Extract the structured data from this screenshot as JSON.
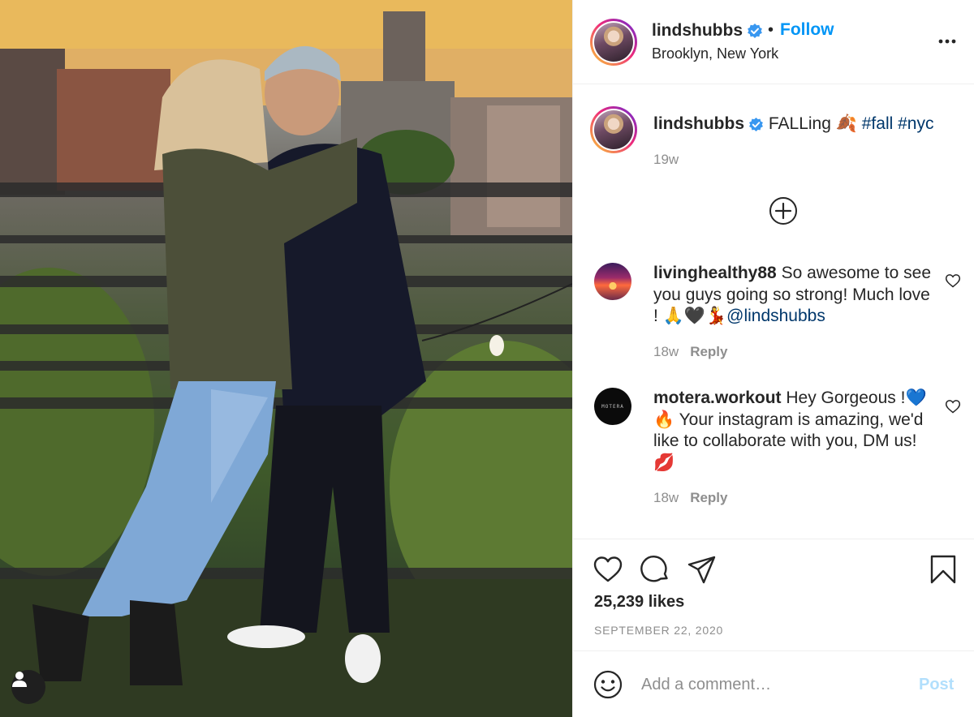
{
  "post": {
    "username": "lindshubbs",
    "follow_label": "Follow",
    "location": "Brooklyn, New York",
    "more_icon": "more-options-icon",
    "verified_color": "#3897f0"
  },
  "caption": {
    "username": "lindshubbs",
    "text": "FALLing",
    "emoji": "🍂",
    "hashtags": [
      "#fall",
      "#nyc"
    ],
    "time": "19w"
  },
  "load_more_icon": "plus-circle-icon",
  "comments": [
    {
      "username": "livinghealthy88",
      "text": "So awesome to see you guys going so strong! Much love ! 🙏🖤💃",
      "mention": "@lindshubbs",
      "time": "18w",
      "reply_label": "Reply"
    },
    {
      "username": "motera.workout",
      "avatar_text": "MOTERA",
      "text": "Hey Gorgeous !💙🔥 Your instagram is amazing, we'd like to collaborate with you, DM us!💋",
      "time": "18w",
      "reply_label": "Reply"
    }
  ],
  "actions": {
    "like_icon": "heart-icon",
    "comment_icon": "comment-icon",
    "share_icon": "share-icon",
    "save_icon": "bookmark-icon"
  },
  "likes": "25,239 likes",
  "date": "SEPTEMBER 22, 2020",
  "comment_box": {
    "placeholder": "Add a comment…",
    "post_label": "Post",
    "post_color": "#b2dffc"
  },
  "colors": {
    "link_blue": "#0095f6",
    "hashtag_blue": "#00376b",
    "muted_text": "#8e8e8e"
  }
}
